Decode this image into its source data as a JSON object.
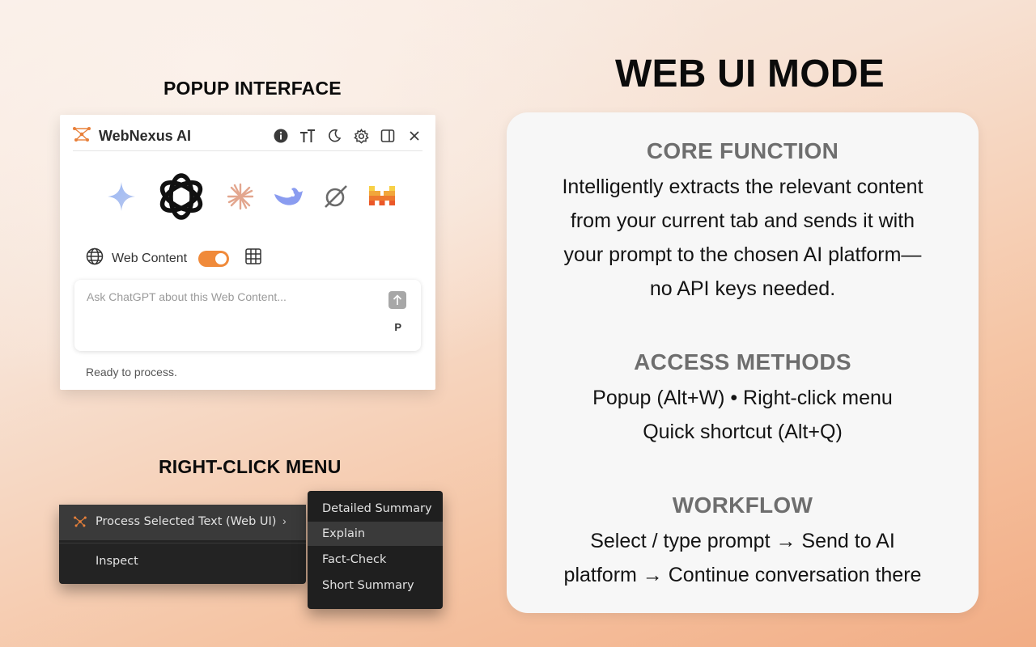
{
  "titles": {
    "popup": "POPUP INTERFACE",
    "right_click": "RIGHT-CLICK MENU",
    "main": "WEB UI MODE"
  },
  "popup": {
    "app_name": "WebNexus AI",
    "header_icons": [
      "info-icon",
      "text-size-icon",
      "moon-icon",
      "gear-icon",
      "sidebar-icon",
      "close-icon"
    ],
    "ai_platforms": [
      "gemini-icon",
      "chatgpt-icon",
      "claude-icon",
      "deepseek-icon",
      "grok-icon",
      "mistral-icon"
    ],
    "selected_platform": "chatgpt-icon",
    "web_content_label": "Web Content",
    "web_content_enabled": true,
    "prompt_placeholder": "Ask ChatGPT about this Web Content...",
    "prompt_value": "",
    "p_label": "P",
    "status": "Ready to process."
  },
  "context_menu": {
    "main_items": [
      {
        "label": "Process Selected Text (Web UI)",
        "submenu_arrow": "›",
        "highlighted": true
      },
      {
        "label": "Inspect",
        "highlighted": false
      }
    ],
    "submenu": [
      {
        "label": "Detailed Summary",
        "highlighted": false
      },
      {
        "label": "Explain",
        "highlighted": true
      },
      {
        "label": "Fact-Check",
        "highlighted": false
      },
      {
        "label": "Short Summary",
        "highlighted": false
      }
    ]
  },
  "card": {
    "core_heading": "CORE FUNCTION",
    "core_lines": [
      "Intelligently extracts the relevant content",
      "from your current tab and sends it with",
      "your prompt to the chosen AI platform—",
      "no API keys needed."
    ],
    "access_heading": "ACCESS METHODS",
    "access_lines": [
      "Popup (Alt+W)  •  Right-click menu",
      "Quick shortcut (Alt+Q)"
    ],
    "workflow_heading": "WORKFLOW",
    "workflow_lines": [
      "Select / type prompt  →  Send to AI",
      "platform  →  Continue conversation there"
    ]
  },
  "colors": {
    "toggle_on": "#f08a3a",
    "logo_orange": "#e8803a",
    "menu_bg": "#232323",
    "menu_highlight": "#3a3a3a"
  }
}
